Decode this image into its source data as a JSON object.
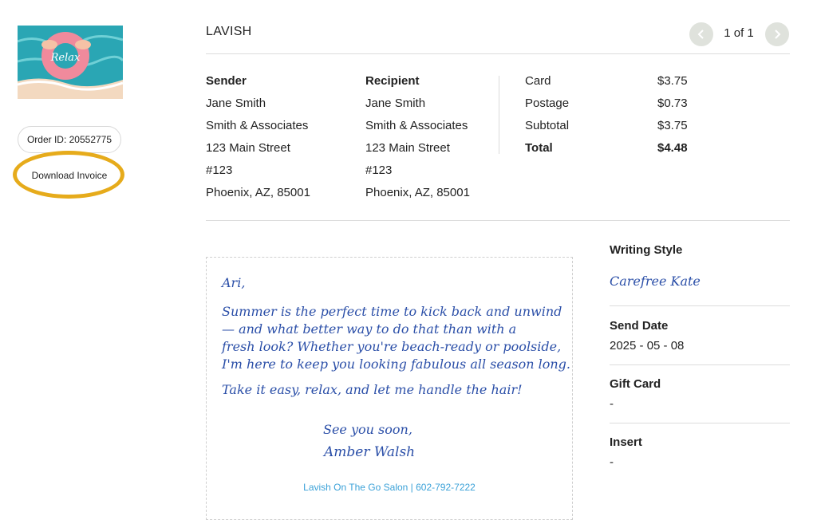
{
  "thumbnail": {
    "text": "Relax"
  },
  "order": {
    "label": "Order ID: 20552775"
  },
  "download": {
    "label": "Download Invoice"
  },
  "header": {
    "brand": "LAVISH",
    "page_indicator": "1 of 1"
  },
  "sender": {
    "heading": "Sender",
    "name": "Jane Smith",
    "company": "Smith & Associates",
    "street": "123 Main Street",
    "unit": "#123",
    "city": "Phoenix, AZ, 85001"
  },
  "recipient": {
    "heading": "Recipient",
    "name": "Jane Smith",
    "company": "Smith & Associates",
    "street": "123 Main Street",
    "unit": "#123",
    "city": "Phoenix, AZ, 85001"
  },
  "costs": {
    "card_label": "Card",
    "card_value": "$3.75",
    "postage_label": "Postage",
    "postage_value": "$0.73",
    "subtotal_label": "Subtotal",
    "subtotal_value": "$3.75",
    "total_label": "Total",
    "total_value": "$4.48"
  },
  "letter": {
    "greeting": "Ari,",
    "body": "Summer is the perfect time to kick back and unwind\n— and what better way to do that than with a\nfresh look? Whether you're beach-ready or poolside,\nI'm here to keep you looking fabulous all season long.",
    "body2": "Take it easy, relax, and let me handle the hair!",
    "closing": "See you soon,",
    "signature": "Amber Walsh",
    "footer": "Lavish On The Go Salon | 602-792-7222"
  },
  "details": {
    "writing_style_label": "Writing Style",
    "writing_style_value": "Carefree Kate",
    "send_date_label": "Send Date",
    "send_date_value": "2025 - 05 - 08",
    "gift_card_label": "Gift Card",
    "gift_card_value": "-",
    "insert_label": "Insert",
    "insert_value": "-"
  },
  "icons": {
    "prev": "chevron-left-icon",
    "next": "chevron-right-icon"
  },
  "colors": {
    "highlight_ring": "#e6ab1b",
    "handwriting": "#2b4fa8",
    "footer_link": "#3aa1d8",
    "pager_button": "#dfe2dc"
  }
}
